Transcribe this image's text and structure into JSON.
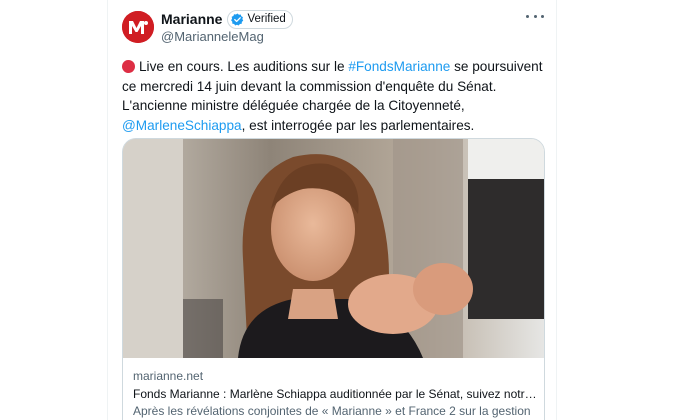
{
  "account": {
    "name": "Marianne",
    "verified_label": "Verified",
    "handle": "@MarianneleMag",
    "avatar_letter": "M"
  },
  "tweet": {
    "live_text": "Live en cours. Les auditions sur le ",
    "hashtag": "#FondsMarianne",
    "text_2": " se poursuivent ce mercredi 14 juin devant la commission d'enquête du Sénat. L'ancienne ministre déléguée chargée de la Citoyenneté, ",
    "mention": "@MarleneSchiappa",
    "text_3": ", est interrogée par les parlementaires."
  },
  "link_card": {
    "domain": "marianne.net",
    "title": "Fonds Marianne : Marlène Schiappa auditionnée par le Sénat, suivez notre di...",
    "description": "Après les révélations conjointes de « Marianne » et France 2 sur la gestion"
  },
  "colors": {
    "brand_red": "#d01d23",
    "link_blue": "#1d9bf0",
    "verified_blue": "#1d9bf0",
    "live_dot": "#dd2e44"
  },
  "icons": {
    "more": "more-dots-icon",
    "verified": "verified-check-icon",
    "live": "red-circle-icon"
  }
}
